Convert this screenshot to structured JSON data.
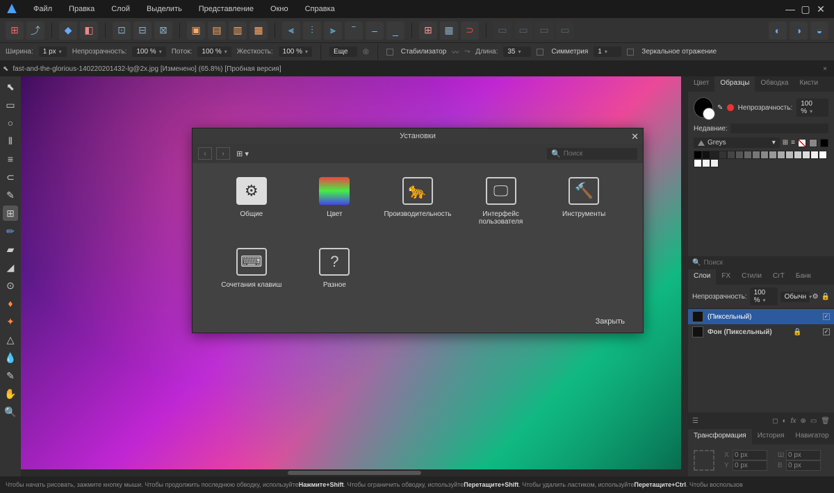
{
  "menu": [
    "Файл",
    "Правка",
    "Слой",
    "Выделить",
    "Представление",
    "Окно",
    "Справка"
  ],
  "optbar": {
    "width_label": "Ширина:",
    "width": "1 px",
    "opacity_label": "Непрозрачность:",
    "opacity": "100 %",
    "flow_label": "Поток:",
    "flow": "100 %",
    "hardness_label": "Жесткость:",
    "hardness": "100 %",
    "more": "Еще",
    "stabilizer": "Стабилизатор",
    "length_label": "Длина:",
    "length": "35",
    "symmetry": "Симметрия",
    "symmetry_val": "1",
    "mirror": "Зеркальное отражение"
  },
  "doc": {
    "title": "fast-and-the-glorious-140220201432-lg@2x.jpg [Изменено] (65.8%) [Пробная версия]"
  },
  "dialog": {
    "title": "Установки",
    "search_ph": "Поиск",
    "close": "Закрыть",
    "cats": [
      "Общие",
      "Цвет",
      "Производительность",
      "Интерфейс пользователя",
      "Инструменты",
      "Сочетания клавиш",
      "Разное"
    ]
  },
  "panels": {
    "color_tabs": [
      "Цвет",
      "Образцы",
      "Обводка",
      "Кисти"
    ],
    "opacity_label": "Непрозрачность:",
    "opacity": "100 %",
    "recent": "Недавние:",
    "palette": "Greys",
    "search_ph": "Поиск",
    "layer_tabs": [
      "Слои",
      "FX",
      "Стили",
      "СгТ",
      "Банк"
    ],
    "layer_opacity": "Непрозрачность:",
    "layer_opacity_val": "100 %",
    "blend": "Обычн",
    "layers": [
      {
        "name": "(Пиксельный)",
        "sel": true,
        "locked": false
      },
      {
        "name": "Фон (Пиксельный)",
        "sel": false,
        "locked": true
      }
    ],
    "transform_tabs": [
      "Трансформация",
      "История",
      "Навигатор"
    ],
    "xf_zero": "0 px"
  },
  "status": {
    "parts": [
      "Чтобы начать рисовать, зажмите кнопку мыши. Чтобы продолжить последнюю обводку, используйте ",
      "Нажмите+Shift",
      ". Чтобы ограничить обводку, используйте ",
      "Перетащите+Shift",
      ". Чтобы удалить ластиком, используйте ",
      "Перетащите+Ctrl",
      ". Чтобы воспользов"
    ]
  }
}
